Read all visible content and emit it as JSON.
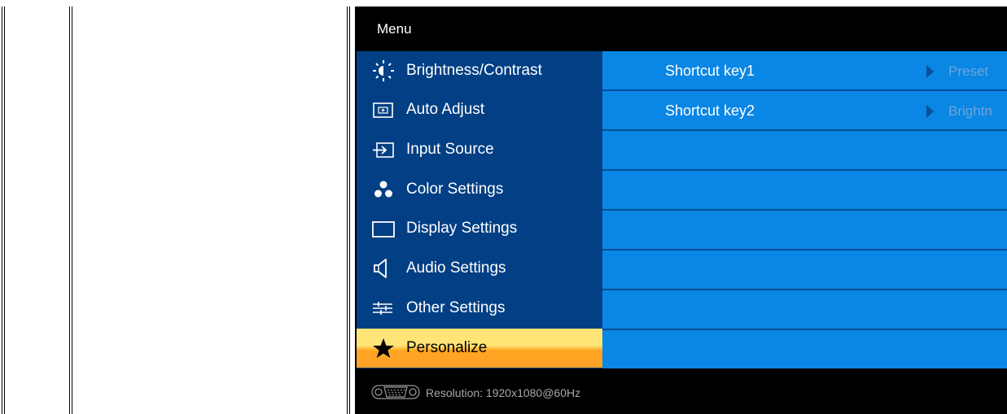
{
  "osd": {
    "title": "Menu",
    "menu_items": [
      {
        "label": "Brightness/Contrast",
        "icon": "brightness-icon"
      },
      {
        "label": "Auto Adjust",
        "icon": "auto-adjust-icon"
      },
      {
        "label": "Input Source",
        "icon": "input-source-icon"
      },
      {
        "label": "Color Settings",
        "icon": "color-settings-icon"
      },
      {
        "label": "Display Settings",
        "icon": "display-settings-icon"
      },
      {
        "label": "Audio Settings",
        "icon": "speaker-icon"
      },
      {
        "label": "Other Settings",
        "icon": "sliders-icon"
      },
      {
        "label": "Personalize",
        "icon": "star-icon",
        "active": true
      }
    ],
    "panel_rows": [
      {
        "key": "Shortcut key1",
        "value": "Preset"
      },
      {
        "key": "Shortcut key2",
        "value": "Brightn"
      }
    ],
    "footer": {
      "connector_icon": "vga-connector-icon",
      "resolution": "Resolution:  1920x1080@60Hz"
    },
    "colors": {
      "menu_bg": "#023f84",
      "panel_bg": "#0a86e4",
      "active_top": "#ffe476",
      "active_bottom": "#ffa12a",
      "frame_bg": "#000000"
    }
  }
}
